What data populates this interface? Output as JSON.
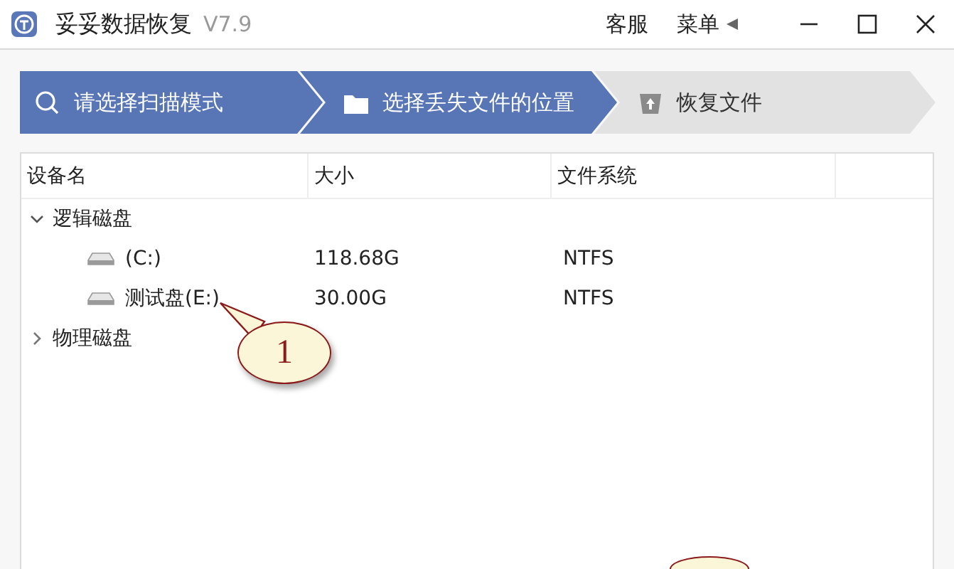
{
  "window": {
    "title": "妥妥数据恢复",
    "version": "V7.9",
    "actions": [
      "客服",
      "菜单"
    ]
  },
  "steps": [
    {
      "label": "请选择扫描模式",
      "active": true
    },
    {
      "label": "选择丢失文件的位置",
      "active": true
    },
    {
      "label": "恢复文件",
      "active": false
    }
  ],
  "table": {
    "columns": [
      "设备名",
      "大小",
      "文件系统"
    ],
    "groups": [
      {
        "name": "逻辑磁盘",
        "expanded": true,
        "children": [
          {
            "name": "(C:)",
            "size": "118.68G",
            "fs": "NTFS"
          },
          {
            "name": "测试盘(E:)",
            "size": "30.00G",
            "fs": "NTFS"
          }
        ]
      },
      {
        "name": "物理磁盘",
        "expanded": false
      }
    ]
  },
  "callouts": [
    {
      "kind": "full",
      "label": "1"
    },
    {
      "kind": "partial"
    }
  ]
}
